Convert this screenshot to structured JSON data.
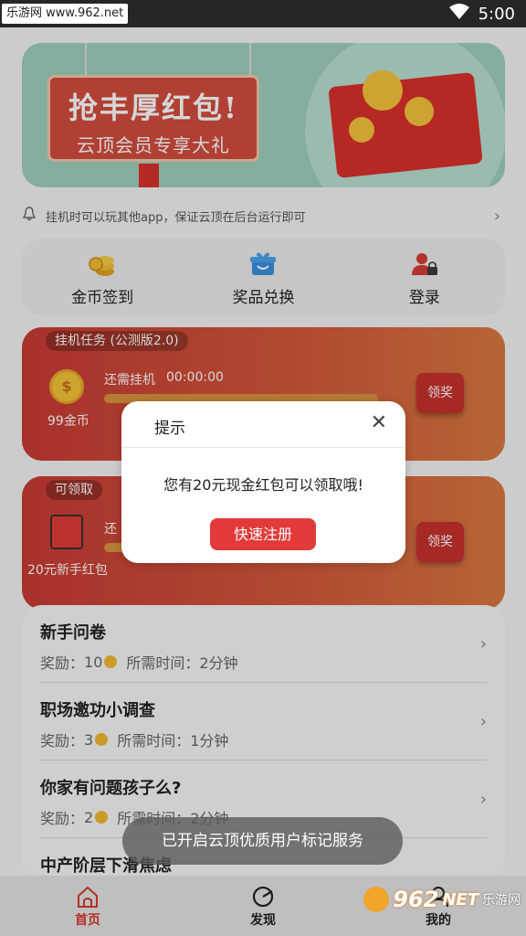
{
  "status_bar": {
    "watermark": "乐游网 www.962.net",
    "time": "5:00"
  },
  "banner": {
    "title": "抢丰厚红包!",
    "subtitle": "云顶会员专享大礼"
  },
  "notice": {
    "text": "挂机时可以玩其他app，保证云顶在后台运行即可"
  },
  "quick_actions": [
    {
      "label": "金币签到",
      "icon": "coin-stack-icon"
    },
    {
      "label": "奖品兑换",
      "icon": "gift-box-icon"
    },
    {
      "label": "登录",
      "icon": "user-lock-icon"
    }
  ],
  "idle_task": {
    "tag": "挂机任务 (公测版2.0)",
    "coins": "99金币",
    "remaining_label": "还需挂机",
    "timer": "00:00:00",
    "button": "领奖"
  },
  "redpack_task": {
    "tag": "可领取",
    "label_prefix": "还",
    "reward": "20元新手红包",
    "button": "领奖"
  },
  "surveys": [
    {
      "title": "新手问卷",
      "reward_label": "奖励：",
      "reward": "10",
      "time_label": "所需时间：",
      "time": "2分钟"
    },
    {
      "title": "职场邀功小调查",
      "reward_label": "奖励：",
      "reward": "3",
      "time_label": "所需时间：",
      "time": "1分钟"
    },
    {
      "title": "你家有问题孩子么?",
      "reward_label": "奖励：",
      "reward": "2",
      "time_label": "所需时间：",
      "time": "2分钟"
    },
    {
      "title": "中产阶层下滑焦虑"
    }
  ],
  "bottom_nav": [
    {
      "label": "首页",
      "active": true
    },
    {
      "label": "发现",
      "active": false
    },
    {
      "label": "我的",
      "active": false
    }
  ],
  "toast": {
    "text": "已开启云顶优质用户标记服务"
  },
  "dialog": {
    "title": "提示",
    "message": "您有20元现金红包可以领取哦!",
    "button": "快速注册"
  },
  "branding": {
    "number": "962",
    "suffix": "NET",
    "name": "乐游网"
  },
  "colors": {
    "accent_red": "#e23a3a",
    "card_red": "#c93b35",
    "card_orange": "#d97940",
    "banner_green": "#9fcfbd"
  }
}
